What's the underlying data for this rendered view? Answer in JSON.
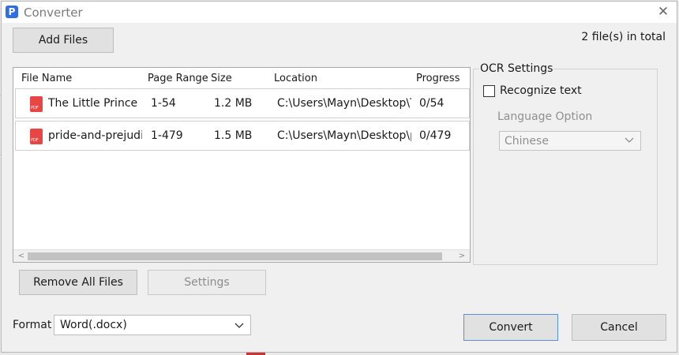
{
  "window": {
    "title": "Converter",
    "close_symbol": "✕"
  },
  "toolbar": {
    "add_files_label": "Add Files",
    "file_count": "2 file(s) in total"
  },
  "table": {
    "columns": [
      "File Name",
      "Page Range",
      "Size",
      "Location",
      "Progress"
    ],
    "rows": [
      {
        "file_name": "The Little Prince",
        "page_range": "1-54",
        "size": "1.2 MB",
        "location": "C:\\Users\\Mayn\\Desktop\\T",
        "progress": "0/54"
      },
      {
        "file_name": "pride-and-prejudi",
        "page_range": "1-479",
        "size": "1.5 MB",
        "location": "C:\\Users\\Mayn\\Desktop\\p",
        "progress": "0/479"
      }
    ]
  },
  "ocr": {
    "title": "OCR Settings",
    "recognize_label": "Recognize text",
    "language_label": "Language Option",
    "language_value": "Chinese"
  },
  "actions": {
    "remove_all_label": "Remove All Files",
    "settings_label": "Settings",
    "convert_label": "Convert",
    "cancel_label": "Cancel"
  },
  "format": {
    "label": "Format",
    "value": "Word(.docx)"
  },
  "icons": {
    "file": "pdf-file-icon",
    "accent": "#e84545"
  }
}
